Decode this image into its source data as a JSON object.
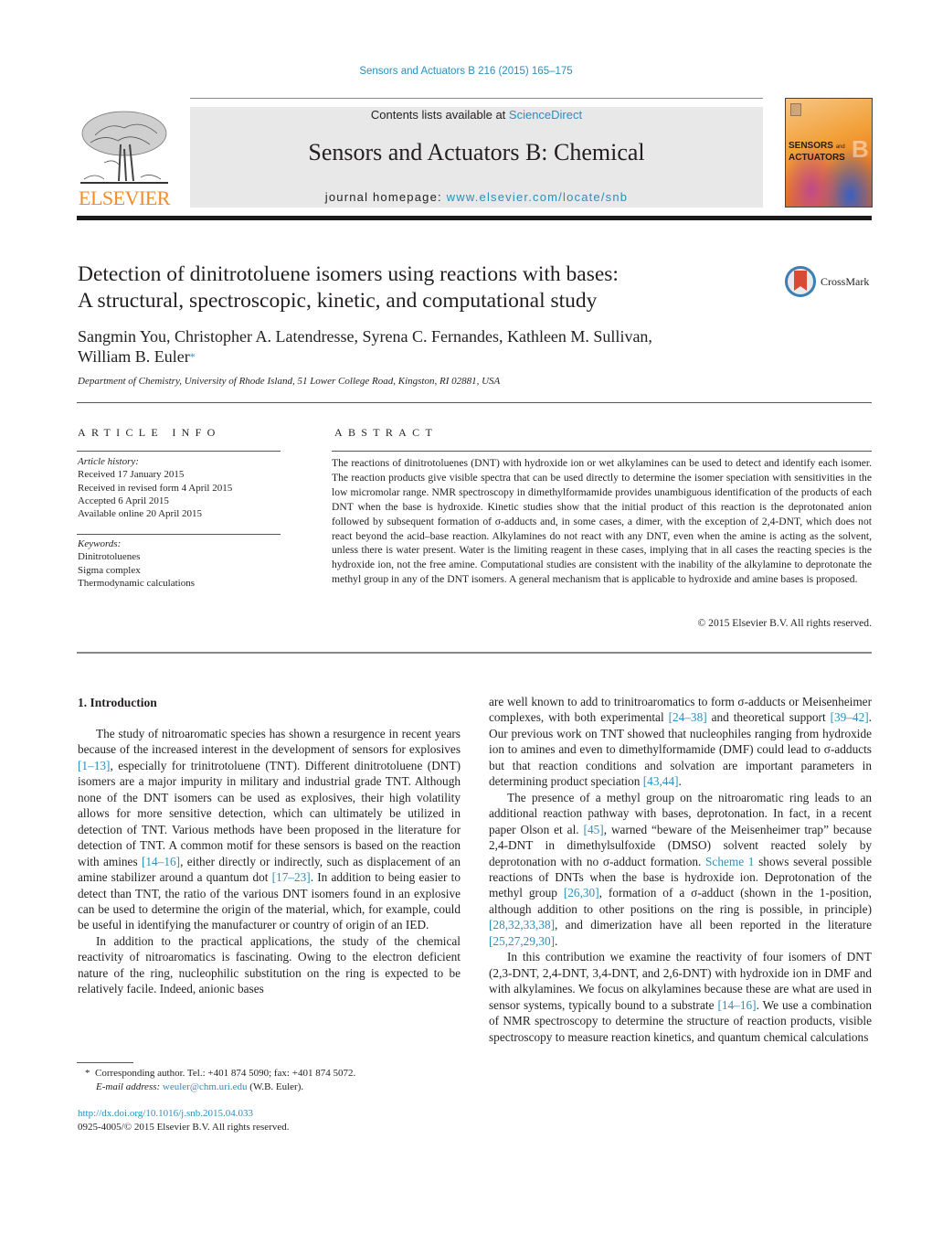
{
  "header": {
    "journal_ref": "Sensors and Actuators B 216 (2015) 165–175",
    "contents_prefix": "Contents lists available at ",
    "contents_link": "ScienceDirect",
    "journal_name": "Sensors and Actuators B: Chemical",
    "homepage_prefix": "journal homepage: ",
    "homepage_link": "www.elsevier.com/locate/snb",
    "publisher_logo_text": "ELSEVIER",
    "cover": {
      "line1": "SENSORS",
      "and": "and",
      "line2": "ACTUATORS",
      "letter": "B"
    },
    "colors": {
      "link": "#2a8fbd",
      "elsevier_orange": "#f28c28"
    }
  },
  "article": {
    "title_line1": "Detection of dinitrotoluene isomers using reactions with bases:",
    "title_line2": "A structural, spectroscopic, kinetic, and computational study",
    "crossmark_label": "CrossMark",
    "authors_line1": "Sangmin You, Christopher A. Latendresse, Syrena C. Fernandes, Kathleen M. Sullivan,",
    "authors_line2": "William B. Euler",
    "corresponding_mark": "*",
    "affiliation": "Department of Chemistry, University of Rhode Island, 51 Lower College Road, Kingston, RI 02881, USA"
  },
  "article_info": {
    "heading": "ARTICLE INFO",
    "history_label": "Article history:",
    "history": [
      "Received 17 January 2015",
      "Received in revised form 4 April 2015",
      "Accepted 6 April 2015",
      "Available online 20 April 2015"
    ],
    "keywords_label": "Keywords:",
    "keywords": [
      "Dinitrotoluenes",
      "Sigma complex",
      "Thermodynamic calculations"
    ]
  },
  "abstract": {
    "heading": "ABSTRACT",
    "text": "The reactions of dinitrotoluenes (DNT) with hydroxide ion or wet alkylamines can be used to detect and identify each isomer. The reaction products give visible spectra that can be used directly to determine the isomer speciation with sensitivities in the low micromolar range. NMR spectroscopy in dimethylformamide provides unambiguous identification of the products of each DNT when the base is hydroxide. Kinetic studies show that the initial product of this reaction is the deprotonated anion followed by subsequent formation of σ-adducts and, in some cases, a dimer, with the exception of 2,4-DNT, which does not react beyond the acid–base reaction. Alkylamines do not react with any DNT, even when the amine is acting as the solvent, unless there is water present. Water is the limiting reagent in these cases, implying that in all cases the reacting species is the hydroxide ion, not the free amine. Computational studies are consistent with the inability of the alkylamine to deprotonate the methyl group in any of the DNT isomers. A general mechanism that is applicable to hydroxide and amine bases is proposed.",
    "copyright": "© 2015 Elsevier B.V. All rights reserved."
  },
  "body": {
    "section_heading": "1.  Introduction",
    "left": {
      "p1_a": "The study of nitroaromatic species has shown a resurgence in recent years because of the increased interest in the development of sensors for explosives ",
      "p1_ref1": "[1–13]",
      "p1_b": ", especially for trinitrotoluene (TNT). Different dinitrotoluene (DNT) isomers are a major impurity in military and industrial grade TNT. Although none of the DNT isomers can be used as explosives, their high volatility allows for more sensitive detection, which can ultimately be utilized in detection of TNT. Various methods have been proposed in the literature for detection of TNT. A common motif for these sensors is based on the reaction with amines ",
      "p1_ref2": "[14–16]",
      "p1_c": ", either directly or indirectly, such as displacement of an amine stabilizer around a quantum dot ",
      "p1_ref3": "[17–23]",
      "p1_d": ". In addition to being easier to detect than TNT, the ratio of the various DNT isomers found in an explosive can be used to determine the origin of the material, which, for example, could be useful in identifying the manufacturer or country of origin of an IED.",
      "p2": "In addition to the practical applications, the study of the chemical reactivity of nitroaromatics is fascinating. Owing to the electron deficient nature of the ring, nucleophilic substitution on the ring is expected to be relatively facile. Indeed, anionic bases"
    },
    "right": {
      "p1_a": "are well known to add to trinitroaromatics to form σ-adducts or Meisenheimer complexes, with both experimental ",
      "p1_ref1": "[24–38]",
      "p1_b": " and theoretical support ",
      "p1_ref2": "[39–42]",
      "p1_c": ". Our previous work on TNT showed that nucleophiles ranging from hydroxide ion to amines and even to dimethylformamide (DMF) could lead to σ-adducts but that reaction conditions and solvation are important parameters in determining product speciation ",
      "p1_ref3": "[43,44]",
      "p1_d": ".",
      "p2_a": "The presence of a methyl group on the nitroaromatic ring leads to an additional reaction pathway with bases, deprotonation. In fact, in a recent paper Olson et al. ",
      "p2_ref1": "[45]",
      "p2_b": ", warned “beware of the Meisenheimer trap” because 2,4-DNT in dimethylsulfoxide (DMSO) solvent reacted solely by deprotonation with no σ-adduct formation. ",
      "p2_ref2": "Scheme 1",
      "p2_c": " shows several possible reactions of DNTs when the base is hydroxide ion. Deprotonation of the methyl group ",
      "p2_ref3": "[26,30]",
      "p2_d": ", formation of a σ-adduct (shown in the 1-position, although addition to other positions on the ring is possible, in principle) ",
      "p2_ref4": "[28,32,33,38]",
      "p2_e": ", and dimerization have all been reported in the literature ",
      "p2_ref5": "[25,27,29,30]",
      "p2_f": ".",
      "p3_a": "In this contribution we examine the reactivity of four isomers of DNT (2,3-DNT, 2,4-DNT, 3,4-DNT, and 2,6-DNT) with hydroxide ion in DMF and with alkylamines. We focus on alkylamines because these are what are used in sensor systems, typically bound to a substrate ",
      "p3_ref1": "[14–16]",
      "p3_b": ". We use a combination of NMR spectroscopy to determine the structure of reaction products, visible spectroscopy to measure reaction kinetics, and quantum chemical calculations"
    }
  },
  "footnote": {
    "mark": "*",
    "line1": "Corresponding author. Tel.: +401 874 5090; fax: +401 874 5072.",
    "email_label": "E-mail address:",
    "email": "weuler@chm.uri.edu",
    "email_suffix": " (W.B. Euler).",
    "doi": "http://dx.doi.org/10.1016/j.snb.2015.04.033",
    "issn_line": "0925-4005/© 2015 Elsevier B.V. All rights reserved."
  }
}
